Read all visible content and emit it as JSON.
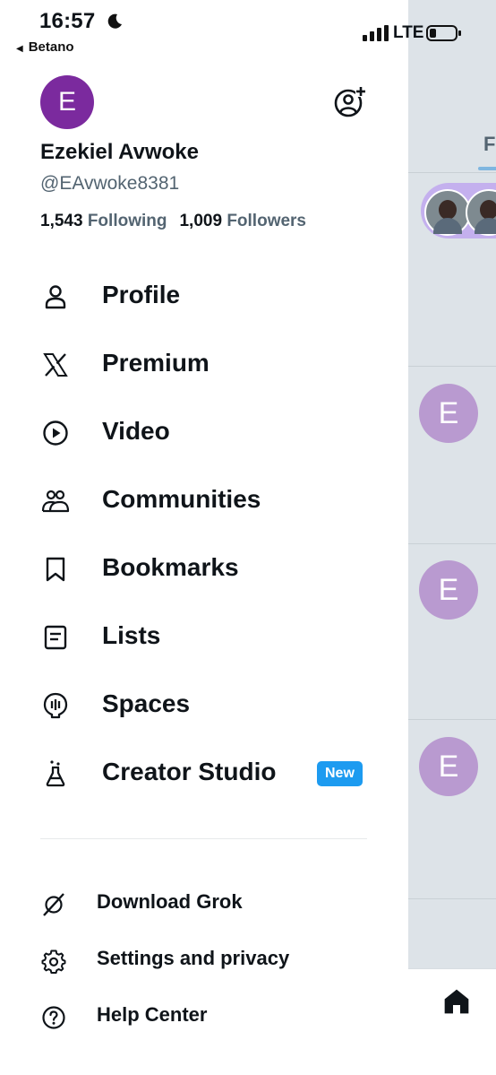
{
  "status_bar": {
    "time": "16:57",
    "back_app": "Betano",
    "network": "LTE",
    "icons": [
      "moon-icon",
      "signal-icon",
      "battery-icon"
    ]
  },
  "profile": {
    "avatar_letter": "E",
    "avatar_color": "#7b2a9e",
    "name": "Ezekiel Avwoke",
    "handle": "@EAvwoke8381",
    "following_count": "1,543",
    "following_label": "Following",
    "followers_count": "1,009",
    "followers_label": "Followers"
  },
  "menu": {
    "items": [
      {
        "label": "Profile",
        "icon": "person-icon"
      },
      {
        "label": "Premium",
        "icon": "x-logo-icon"
      },
      {
        "label": "Video",
        "icon": "play-circle-icon"
      },
      {
        "label": "Communities",
        "icon": "communities-icon"
      },
      {
        "label": "Bookmarks",
        "icon": "bookmark-icon"
      },
      {
        "label": "Lists",
        "icon": "list-icon"
      },
      {
        "label": "Spaces",
        "icon": "spaces-icon"
      },
      {
        "label": "Creator Studio",
        "icon": "flask-icon",
        "badge": "New"
      }
    ]
  },
  "secondary_menu": {
    "items": [
      {
        "label": "Download Grok",
        "icon": "grok-icon"
      },
      {
        "label": "Settings and privacy",
        "icon": "gear-icon"
      },
      {
        "label": "Help Center",
        "icon": "help-icon"
      }
    ]
  },
  "background_timeline": {
    "tab_fragment": "Fo",
    "post_avatar_letter": "E",
    "colors": {
      "accent": "#1d9bf0",
      "badge": "#1d9bf0"
    }
  }
}
